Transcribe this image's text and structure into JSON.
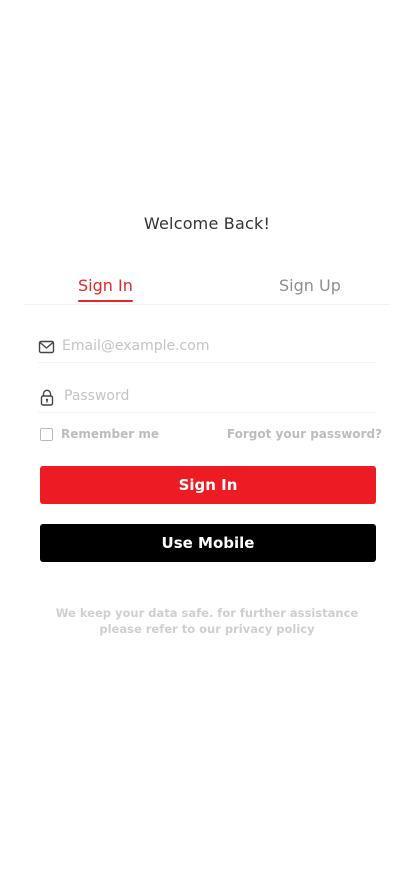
{
  "header": {
    "welcome": "Welcome Back!"
  },
  "tabs": [
    {
      "label": "Sign In",
      "active": true
    },
    {
      "label": "Sign Up",
      "active": false
    }
  ],
  "form": {
    "email": {
      "placeholder": "Email@example.com",
      "value": "",
      "icon": "mail-icon"
    },
    "password": {
      "placeholder": "Password",
      "value": "",
      "icon": "lock-icon"
    },
    "remember_label": "Remember me",
    "remember_checked": false,
    "forgot_label": "Forgot your password?"
  },
  "buttons": {
    "signin_label": "Sign In",
    "mobile_label": "Use Mobile"
  },
  "footer": {
    "privacy_line1": "We keep your data safe. for further assistance",
    "privacy_line2": "please refer to our privacy policy"
  },
  "colors": {
    "accent": "#ed1c24",
    "dark_button": "#000000",
    "muted_text": "#bdbdbd"
  }
}
